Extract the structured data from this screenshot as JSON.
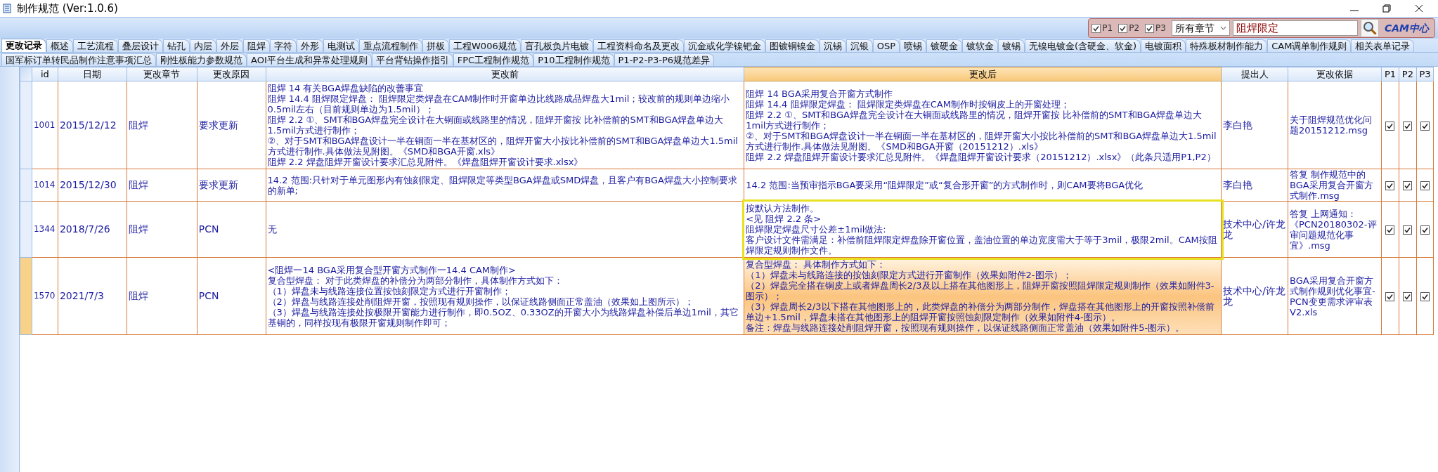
{
  "window": {
    "title": "制作规范 (Ver:1.0.6)"
  },
  "filter": {
    "checks": [
      {
        "label": "P1",
        "checked": true
      },
      {
        "label": "P2",
        "checked": true
      },
      {
        "label": "P3",
        "checked": true
      }
    ],
    "chapter": "所有章节",
    "query": "阻焊限定",
    "logo": "CAM中心"
  },
  "tabs": [
    [
      {
        "label": "更改记录",
        "selected": true
      },
      {
        "label": "概述",
        "selected": false
      },
      {
        "label": "工艺流程",
        "selected": false
      },
      {
        "label": "叠层设计",
        "selected": false
      },
      {
        "label": "钻孔",
        "selected": false
      },
      {
        "label": "内层",
        "selected": false
      },
      {
        "label": "外层",
        "selected": false
      },
      {
        "label": "阻焊",
        "selected": false
      },
      {
        "label": "字符",
        "selected": false
      },
      {
        "label": "外形",
        "selected": false
      },
      {
        "label": "电测试",
        "selected": false
      },
      {
        "label": "重点流程制作",
        "selected": false
      },
      {
        "label": "拼板",
        "selected": false
      },
      {
        "label": "工程W006规范",
        "selected": false
      },
      {
        "label": "盲孔板负片电镀",
        "selected": false
      },
      {
        "label": "工程资料命名及更改",
        "selected": false
      },
      {
        "label": "沉金或化学镍钯金",
        "selected": false
      },
      {
        "label": "图镀铜镍金",
        "selected": false
      },
      {
        "label": "沉锡",
        "selected": false
      },
      {
        "label": "沉银",
        "selected": false
      },
      {
        "label": "OSP",
        "selected": false
      },
      {
        "label": "喷锡",
        "selected": false
      },
      {
        "label": "镀硬金",
        "selected": false
      },
      {
        "label": "镀软金",
        "selected": false
      },
      {
        "label": "镀锡",
        "selected": false
      },
      {
        "label": "无镍电镀金(含硬金、软金)",
        "selected": false
      },
      {
        "label": "电镀面积",
        "selected": false
      },
      {
        "label": "特殊板材制作能力",
        "selected": false
      },
      {
        "label": "CAM调单制作规则",
        "selected": false
      },
      {
        "label": "相关表单记录",
        "selected": false
      }
    ],
    [
      {
        "label": "国军标订单转民品制作注意事项汇总",
        "selected": false
      },
      {
        "label": "刚性板能力参数规范",
        "selected": false
      },
      {
        "label": "AOI平台生成和异常处理规则",
        "selected": false
      },
      {
        "label": "平台背钻操作指引",
        "selected": false
      },
      {
        "label": "FPC工程制作规范",
        "selected": false
      },
      {
        "label": "P10工程制作规范",
        "selected": false
      },
      {
        "label": "P1-P2-P3-P6规范差异",
        "selected": false
      }
    ]
  ],
  "table": {
    "columns": [
      {
        "label": "id",
        "highlighted": false
      },
      {
        "label": "日期",
        "highlighted": false
      },
      {
        "label": "更改章节",
        "highlighted": false
      },
      {
        "label": "更改原因",
        "highlighted": false
      },
      {
        "label": "更改前",
        "highlighted": false
      },
      {
        "label": "更改后",
        "highlighted": true
      },
      {
        "label": "提出人",
        "highlighted": false
      },
      {
        "label": "更改依据",
        "highlighted": false
      },
      {
        "label": "P1",
        "highlighted": false
      },
      {
        "label": "P2",
        "highlighted": false
      },
      {
        "label": "P3",
        "highlighted": false
      }
    ],
    "rows": [
      {
        "id": "1001",
        "date": "2015/12/12",
        "chapter": "阻焊",
        "reason": "要求更新",
        "before": [
          "阻焊 14 有关BGA焊盘缺陷的改善事宜",
          "阻焊 14.4 阻焊限定焊盘： 阻焊限定类焊盘在CAM制作时开窗单边比线路成品焊盘大1mil；较改前的规则单边缩小0.5mil左右（目前规则单边为1.5mil）；",
          "阻焊 2.2 ①、SMT和BGA焊盘完全设计在大铜面或线路里的情况，阻焊开窗按 比补偿前的SMT和BGA焊盘单边大1.5mil方式进行制作；",
          "②、对于SMT和BGA焊盘设计一半在铜面一半在基材区的，阻焊开窗大小按比补偿前的SMT和BGA焊盘单边大1.5mil方式进行制作.具体做法见附图。《SMD和BGA开窗.xls》",
          "阻焊 2.2 焊盘阻焊开窗设计要求汇总见附件。《焊盘阻焊开窗设计要求.xlsx》"
        ],
        "after": [
          "阻焊 14 BGA采用复合开窗方式制作",
          "阻焊 14.4 阻焊限定焊盘： 阻焊限定类焊盘在CAM制作时按铜皮上的开窗处理；",
          "阻焊 2.2 ①、SMT和BGA焊盘完全设计在大铜面或线路里的情况，阻焊开窗按 比补偿前的SMT和BGA焊盘单边大1mil方式进行制作；",
          "②、对于SMT和BGA焊盘设计一半在铜面一半在基材区的，阻焊开窗大小按比补偿前的SMT和BGA焊盘单边大1.5mil方式进行制作.具体做法见附图。《SMD和BGA开窗（20151212）.xls》",
          "阻焊 2.2 焊盘阻焊开窗设计要求汇总见附件。《焊盘阻焊开窗设计要求（20151212）.xlsx》（此条只适用P1,P2）"
        ],
        "framed": false,
        "proposer": "李白艳",
        "basis": "关于阻焊规范优化问题20151212.msg",
        "p1": true,
        "p2": true,
        "p3": true,
        "selected": false
      },
      {
        "id": "1014",
        "date": "2015/12/30",
        "chapter": "阻焊",
        "reason": "要求更新",
        "before": [
          "14.2 范围:只针对于单元图形内有蚀刻限定、阻焊限定等类型BGA焊盘或SMD焊盘，且客户有BGA焊盘大小控制要求的新单;"
        ],
        "after": [
          "14.2 范围:当预审指示BGA要采用“阻焊限定”或“复合形开窗”的方式制作时，则CAM要将BGA优化"
        ],
        "framed": false,
        "proposer": "李白艳",
        "basis": "答复  制作规范中的BGA采用复合开窗方式制作.msg",
        "p1": true,
        "p2": true,
        "p3": true,
        "selected": false
      },
      {
        "id": "1344",
        "date": "2018/7/26",
        "chapter": "阻焊",
        "reason": "PCN",
        "before": [
          "无"
        ],
        "after": [
          "按默认方法制作。",
          "<见 阻焊 2.2 条>",
          "阻焊限定焊盘尺寸公差±1mil做法:",
          "客户设计文件需满足：补偿前阻焊限定焊盘除开窗位置，盖油位置的单边宽度需大于等于3mil，极限2mil。CAM按阻焊限定规则制作文件。"
        ],
        "framed": true,
        "proposer": "技术中心/许龙龙",
        "basis": "答复  上网通知：《PCN20180302-评审问题规范化事宜》.msg",
        "p1": true,
        "p2": true,
        "p3": true,
        "selected": false
      },
      {
        "id": "1570",
        "date": "2021/7/3",
        "chapter": "阻焊",
        "reason": "PCN",
        "before": [
          "<阻焊一14 BGA采用复合型开窗方式制作一14.4 CAM制作>",
          "复合型焊盘： 对于此类焊盘的补偿分为两部分制作，具体制作方式如下：",
          "（1）焊盘未与线路连接位置按蚀刻限定方式进行开窗制作；",
          "（2）焊盘与线路连接处削阻焊开窗，按照现有规则操作，以保证线路侧面正常盖油（效果如上图所示）；",
          "（3）焊盘与线路连接处按极限开窗能力进行制作，即0.5OZ、0.33OZ的开窗大小为线路焊盘补偿后单边1mil，其它基铜的，同样按现有极限开窗规则制作即可；"
        ],
        "after": [
          "复合型焊盘： 具体制作方式如下：",
          "（1）焊盘未与线路连接的按蚀刻限定方式进行开窗制作（效果如附件2-图示）；",
          "（2）焊盘完全搭在铜皮上或者焊盘周长2/3及以上搭在其他图形上，阻焊开窗按照阻焊限定规则制作（效果如附件3-图示）；",
          "（3）焊盘周长2/3以下搭在其他图形上的，此类焊盘的补偿分为两部分制作，焊盘搭在其他图形上的开窗按照补偿前单边+1.5mil，焊盘未搭在其他图形上的阻焊开窗按照蚀刻限定制作（效果如附件4-图示）。",
          "备注：焊盘与线路连接处削阻焊开窗，按照现有规则操作，以保证线路侧面正常盖油（效果如附件5-图示）。"
        ],
        "framed": false,
        "proposer": "技术中心/许龙龙",
        "basis": "BGA采用复合开窗方式制作规则优化事宜-PCN变更需求评审表V2.xls",
        "p1": true,
        "p2": true,
        "p3": true,
        "selected": true
      }
    ]
  }
}
